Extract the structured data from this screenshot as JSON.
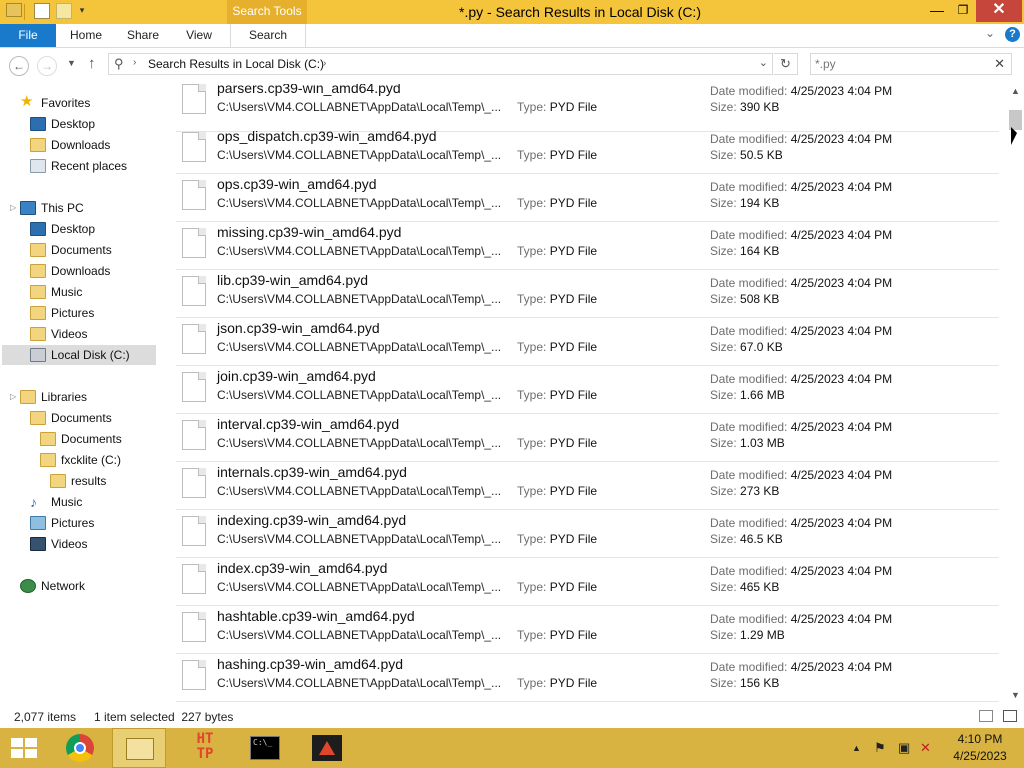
{
  "window": {
    "title": "*.py - Search Results in Local Disk (C:)",
    "contextual_tab": "Search Tools",
    "controls": {
      "minimize": "—",
      "maximize": "❐",
      "close": "✕"
    }
  },
  "ribbon": {
    "tabs": [
      "File",
      "Home",
      "Share",
      "View",
      "Search"
    ],
    "expand_glyph": "⌄",
    "help_glyph": "?"
  },
  "address": {
    "path": "Search Results in Local Disk (C:)",
    "search_value": "*.py",
    "separator": "›"
  },
  "nav": {
    "favorites": {
      "label": "Favorites",
      "items": [
        "Desktop",
        "Downloads",
        "Recent places"
      ]
    },
    "this_pc": {
      "label": "This PC",
      "items": [
        "Desktop",
        "Documents",
        "Downloads",
        "Music",
        "Pictures",
        "Videos",
        "Local Disk (C:)"
      ]
    },
    "libraries": {
      "label": "Libraries",
      "documents": "Documents",
      "documents_children": [
        "Documents",
        "fxcklite (C:)",
        "results"
      ],
      "items": [
        "Music",
        "Pictures",
        "Videos"
      ]
    },
    "network": "Network"
  },
  "labels": {
    "type": "Type:",
    "date_modified": "Date modified:",
    "size": "Size:"
  },
  "files": [
    {
      "name": "parsers.cp39-win_amd64.pyd",
      "path": "C:\\Users\\VM4.COLLABNET\\AppData\\Local\\Temp\\_...",
      "type": "PYD File",
      "date": "4/25/2023 4:04 PM",
      "size": "390 KB"
    },
    {
      "name": "ops_dispatch.cp39-win_amd64.pyd",
      "path": "C:\\Users\\VM4.COLLABNET\\AppData\\Local\\Temp\\_...",
      "type": "PYD File",
      "date": "4/25/2023 4:04 PM",
      "size": "50.5 KB"
    },
    {
      "name": "ops.cp39-win_amd64.pyd",
      "path": "C:\\Users\\VM4.COLLABNET\\AppData\\Local\\Temp\\_...",
      "type": "PYD File",
      "date": "4/25/2023 4:04 PM",
      "size": "194 KB"
    },
    {
      "name": "missing.cp39-win_amd64.pyd",
      "path": "C:\\Users\\VM4.COLLABNET\\AppData\\Local\\Temp\\_...",
      "type": "PYD File",
      "date": "4/25/2023 4:04 PM",
      "size": "164 KB"
    },
    {
      "name": "lib.cp39-win_amd64.pyd",
      "path": "C:\\Users\\VM4.COLLABNET\\AppData\\Local\\Temp\\_...",
      "type": "PYD File",
      "date": "4/25/2023 4:04 PM",
      "size": "508 KB"
    },
    {
      "name": "json.cp39-win_amd64.pyd",
      "path": "C:\\Users\\VM4.COLLABNET\\AppData\\Local\\Temp\\_...",
      "type": "PYD File",
      "date": "4/25/2023 4:04 PM",
      "size": "67.0 KB"
    },
    {
      "name": "join.cp39-win_amd64.pyd",
      "path": "C:\\Users\\VM4.COLLABNET\\AppData\\Local\\Temp\\_...",
      "type": "PYD File",
      "date": "4/25/2023 4:04 PM",
      "size": "1.66 MB"
    },
    {
      "name": "interval.cp39-win_amd64.pyd",
      "path": "C:\\Users\\VM4.COLLABNET\\AppData\\Local\\Temp\\_...",
      "type": "PYD File",
      "date": "4/25/2023 4:04 PM",
      "size": "1.03 MB"
    },
    {
      "name": "internals.cp39-win_amd64.pyd",
      "path": "C:\\Users\\VM4.COLLABNET\\AppData\\Local\\Temp\\_...",
      "type": "PYD File",
      "date": "4/25/2023 4:04 PM",
      "size": "273 KB"
    },
    {
      "name": "indexing.cp39-win_amd64.pyd",
      "path": "C:\\Users\\VM4.COLLABNET\\AppData\\Local\\Temp\\_...",
      "type": "PYD File",
      "date": "4/25/2023 4:04 PM",
      "size": "46.5 KB"
    },
    {
      "name": "index.cp39-win_amd64.pyd",
      "path": "C:\\Users\\VM4.COLLABNET\\AppData\\Local\\Temp\\_...",
      "type": "PYD File",
      "date": "4/25/2023 4:04 PM",
      "size": "465 KB"
    },
    {
      "name": "hashtable.cp39-win_amd64.pyd",
      "path": "C:\\Users\\VM4.COLLABNET\\AppData\\Local\\Temp\\_...",
      "type": "PYD File",
      "date": "4/25/2023 4:04 PM",
      "size": "1.29 MB"
    },
    {
      "name": "hashing.cp39-win_amd64.pyd",
      "path": "C:\\Users\\VM4.COLLABNET\\AppData\\Local\\Temp\\_...",
      "type": "PYD File",
      "date": "4/25/2023 4:04 PM",
      "size": "156 KB"
    }
  ],
  "status": {
    "item_count": "2,077 items",
    "selection": "1 item selected  227 bytes"
  },
  "taskbar": {
    "http_label": "HT\nTP",
    "cmd_label": "C:\\_",
    "clock_time": "4:10 PM",
    "clock_date": "4/25/2023"
  },
  "colors": {
    "titlebar": "#f4c43a",
    "file_tab": "#1979ca",
    "close_button": "#c7463c",
    "taskbar": "#d8b342"
  }
}
